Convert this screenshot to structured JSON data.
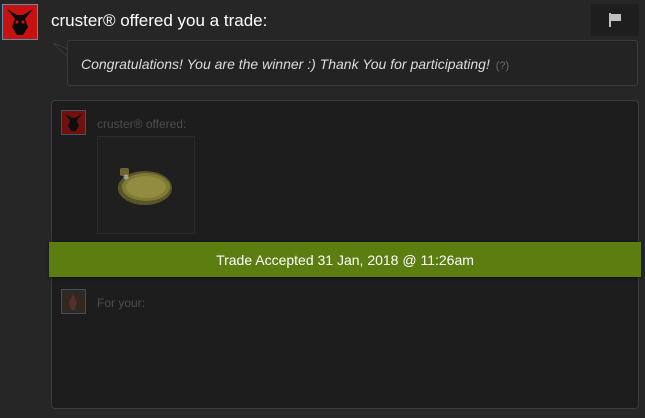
{
  "header": {
    "title": "cruster® offered you a trade:",
    "avatar_icon": "red-demon-avatar-icon",
    "report_icon": "flag-icon"
  },
  "message": {
    "text": "Congratulations! You are the winner :) Thank You for participating!",
    "help_link": "(?)"
  },
  "trade": {
    "them_label": "cruster® offered:",
    "them_items": [
      {
        "icon": "pocket-watch-icon"
      }
    ],
    "your_label": "For your:",
    "status_banner": "Trade Accepted 31 Jan, 2018 @ 11:26am",
    "banner_color": "#5c7e10"
  }
}
